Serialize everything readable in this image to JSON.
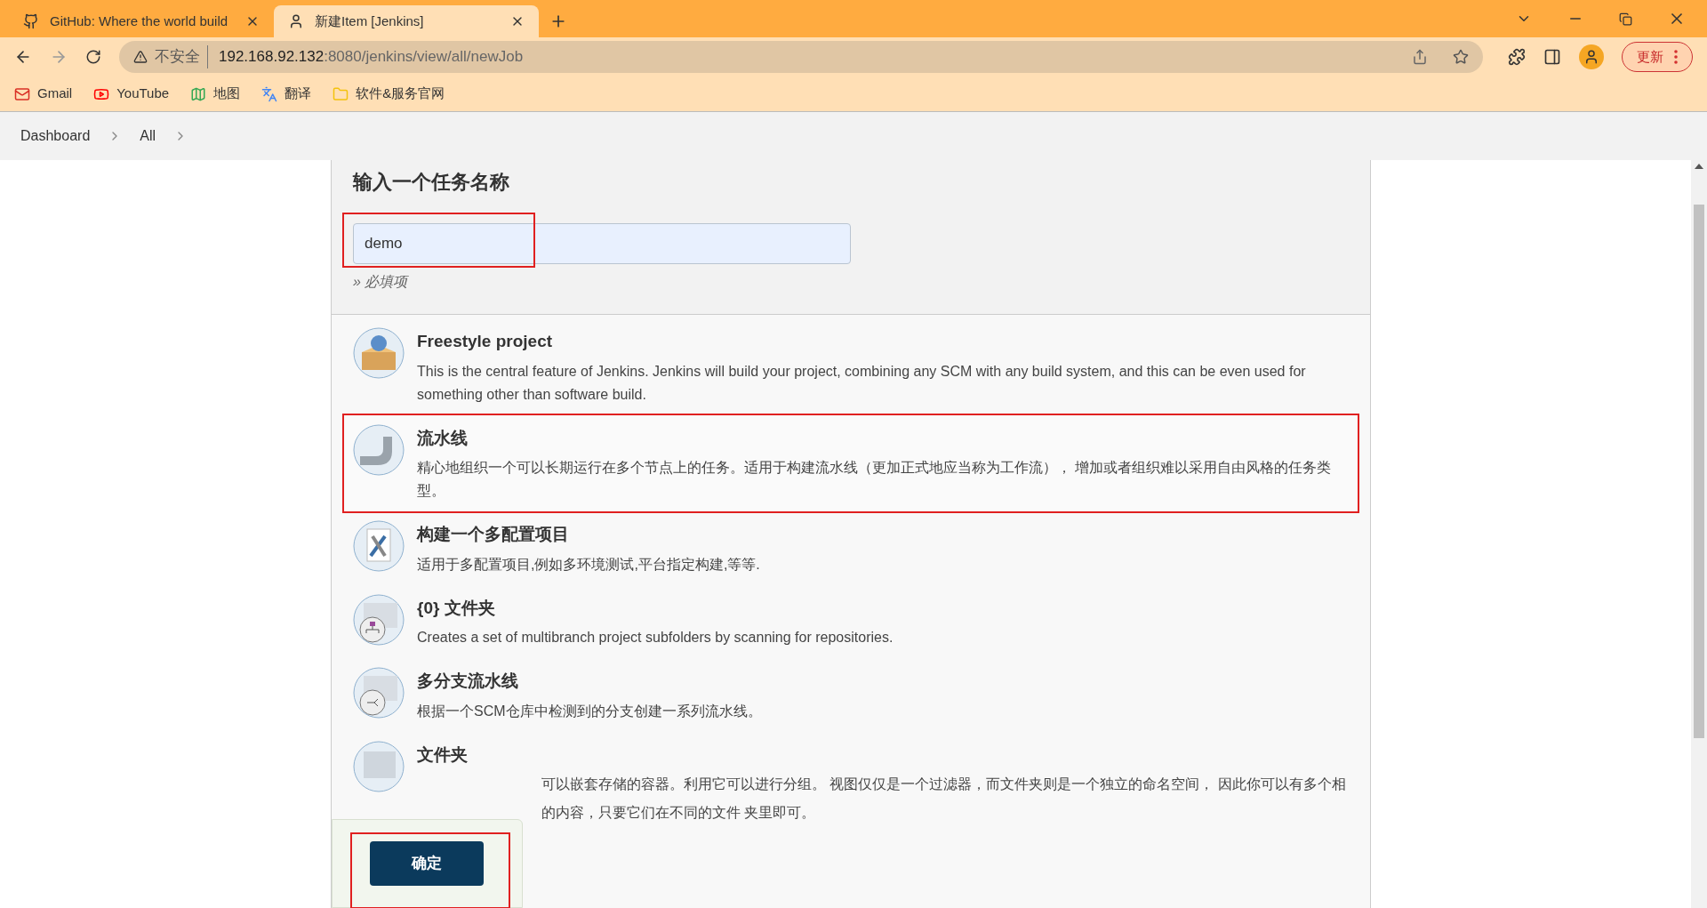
{
  "browser": {
    "tabs": [
      {
        "title": "GitHub: Where the world build",
        "selected": false
      },
      {
        "title": "新建Item [Jenkins]",
        "selected": true
      }
    ],
    "security_label": "不安全",
    "url_host": "192.168.92.132",
    "url_rest": ":8080/jenkins/view/all/newJob",
    "update_button": "更新",
    "bookmarks": [
      {
        "label": "Gmail"
      },
      {
        "label": "YouTube"
      },
      {
        "label": "地图"
      },
      {
        "label": "翻译"
      },
      {
        "label": "软件&服务官网"
      }
    ]
  },
  "breadcrumbs": [
    "Dashboard",
    "All"
  ],
  "form": {
    "heading": "输入一个任务名称",
    "name_value": "demo",
    "required_hint": "» 必填项"
  },
  "item_types": [
    {
      "kind": "freestyle",
      "title": "Freestyle project",
      "description": "This is the central feature of Jenkins. Jenkins will build your project, combining any SCM with any build system, and this can be even used for something other than software build.",
      "selected": false
    },
    {
      "kind": "pipeline",
      "title": "流水线",
      "description": "精心地组织一个可以长期运行在多个节点上的任务。适用于构建流水线（更加正式地应当称为工作流）， 增加或者组织难以采用自由风格的任务类型。",
      "selected": true
    },
    {
      "kind": "matrix",
      "title": "构建一个多配置项目",
      "description": "适用于多配置项目,例如多环境测试,平台指定构建,等等.",
      "selected": false
    },
    {
      "kind": "orgfolder",
      "title": "{0} 文件夹",
      "description": "Creates a set of multibranch project subfolders by scanning for repositories.",
      "selected": false
    },
    {
      "kind": "multibranch",
      "title": "多分支流水线",
      "description": "根据一个SCM仓库中检测到的分支创建一系列流水线。",
      "selected": false
    },
    {
      "kind": "folder",
      "title": "文件夹",
      "description_lines": [
        "可以嵌套存储的容器。利用它可以进行分组。 视图仅仅是一个过滤器，而文件夹则是一个独立的命名空间， 因此你可以有多个相",
        "的内容，只要它们在不同的文件 夹里即可。"
      ],
      "selected": false
    }
  ],
  "ok_button": "确定"
}
